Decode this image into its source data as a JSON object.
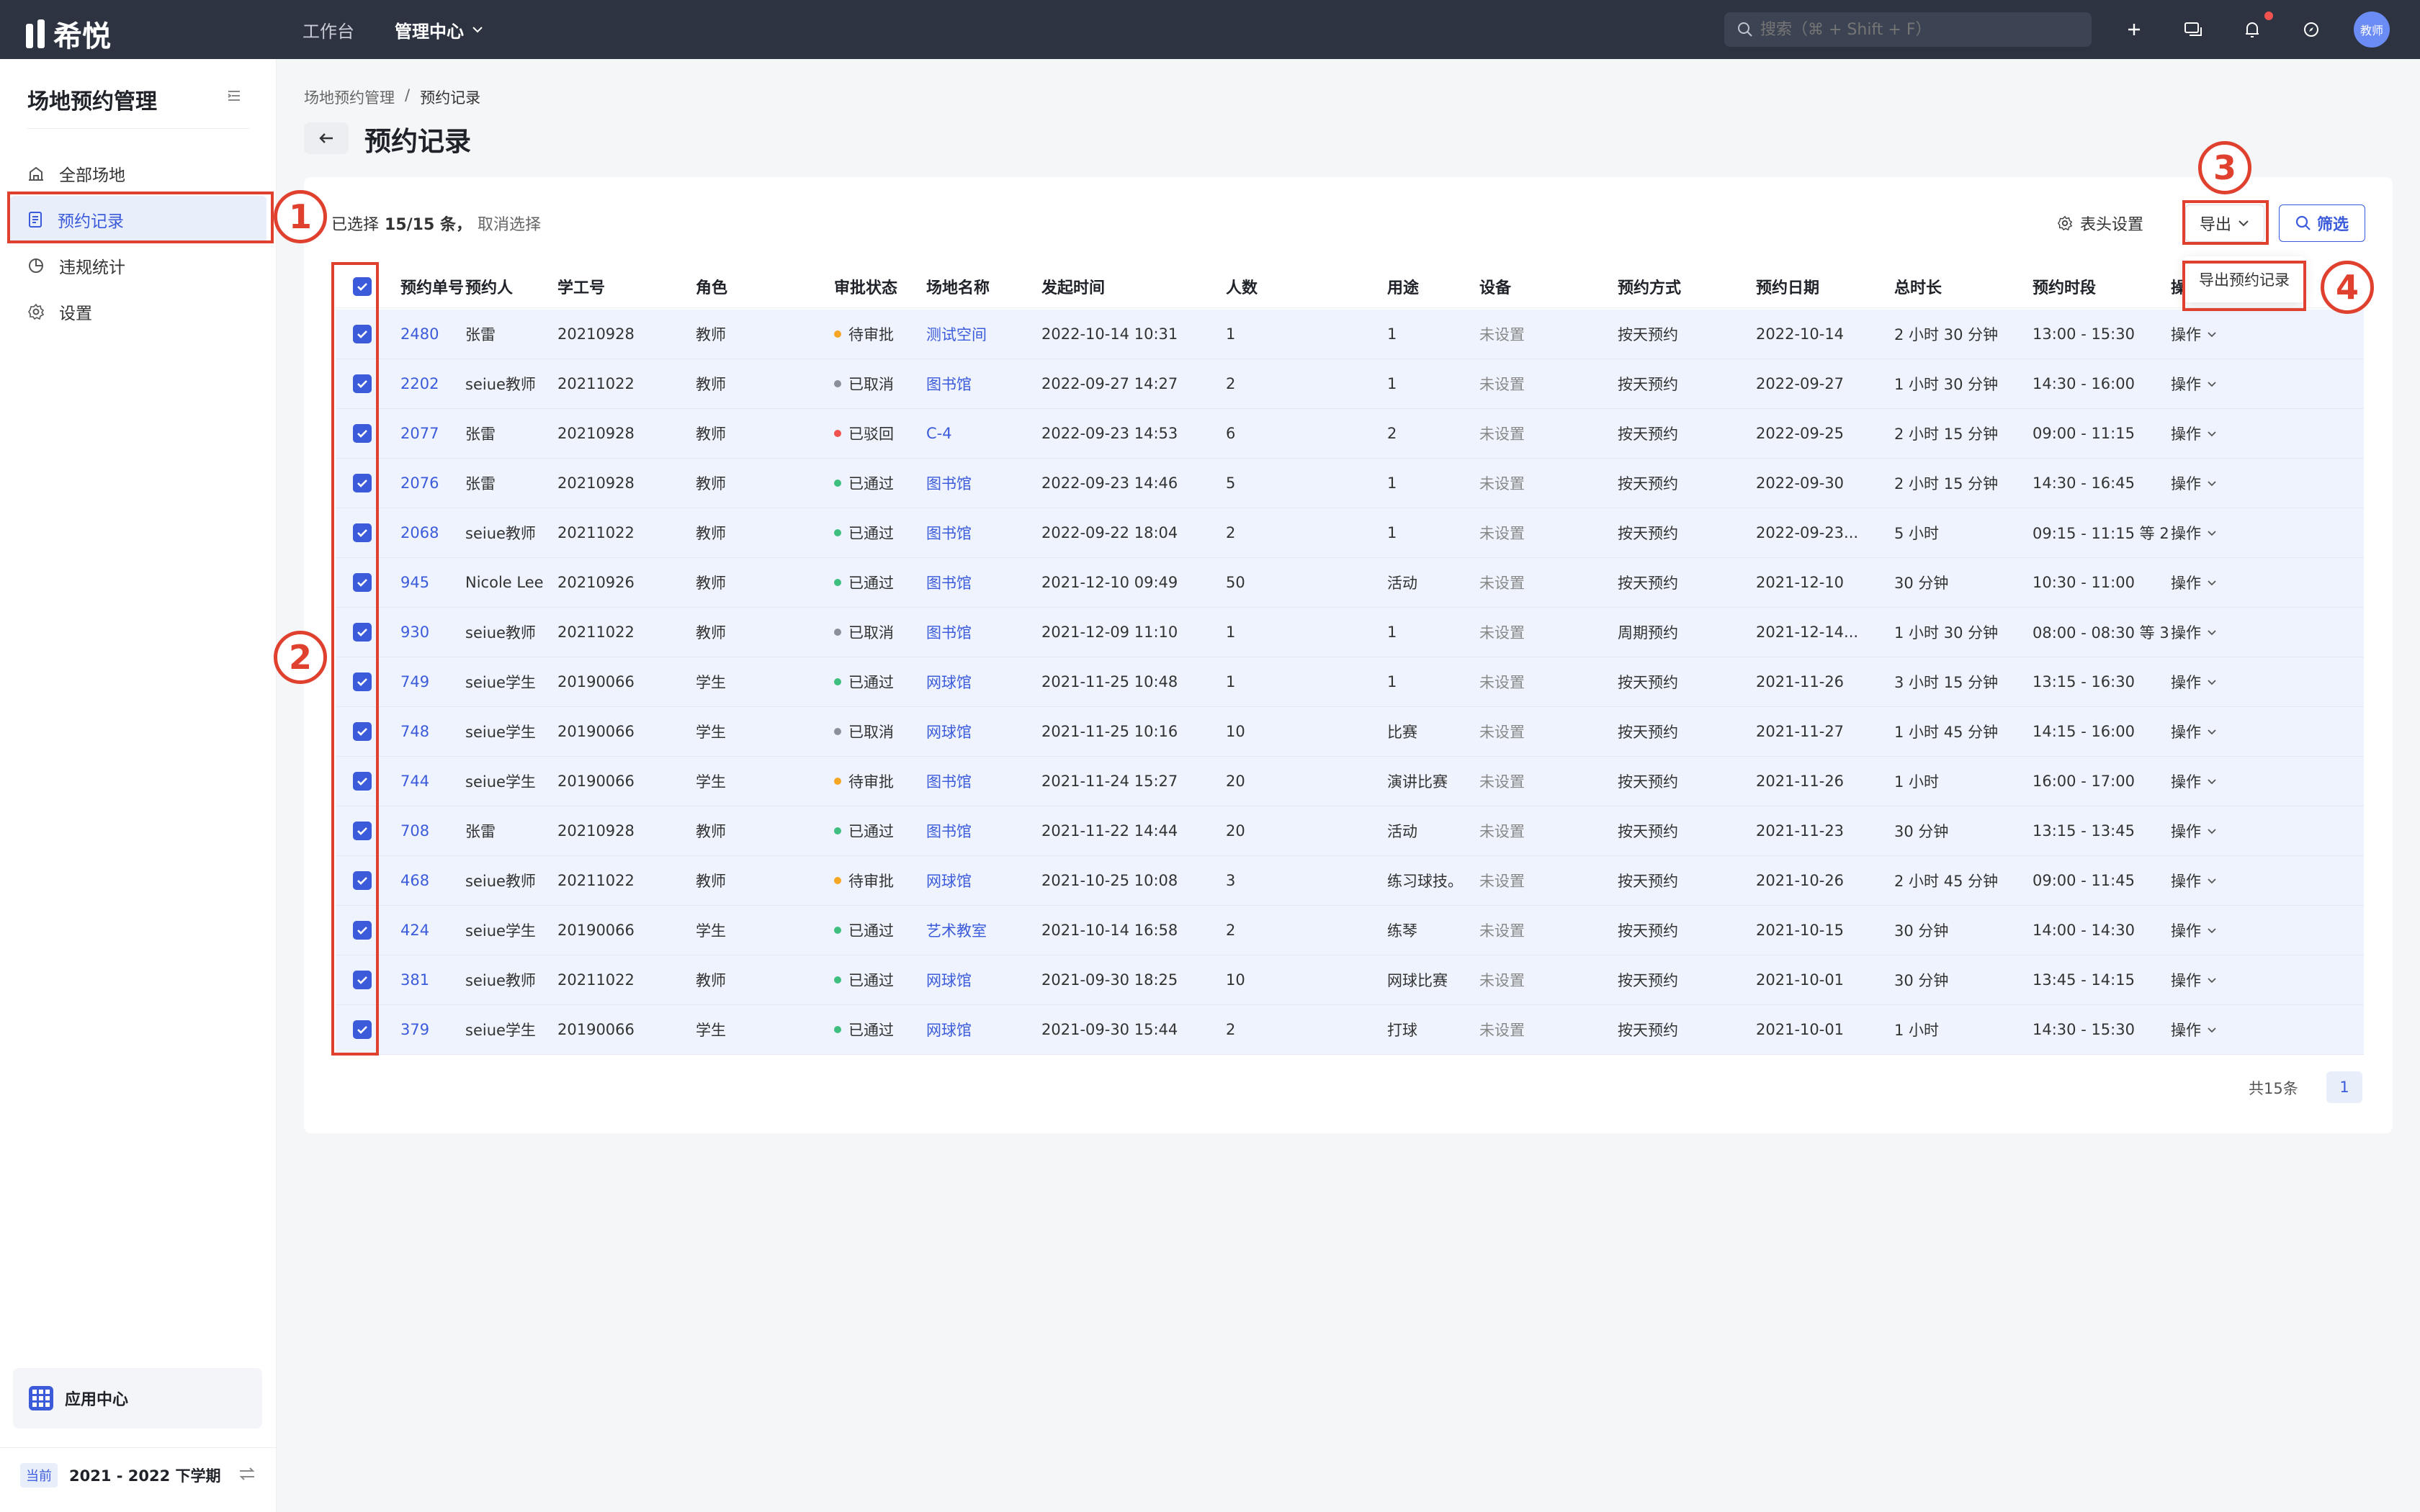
{
  "app": {
    "logo_text": "希悦"
  },
  "topnav": {
    "workspace": "工作台",
    "admin_center": "管理中心"
  },
  "search": {
    "placeholder": "搜索（⌘ + Shift + F）"
  },
  "avatar": {
    "label": "教师"
  },
  "sidebar": {
    "title": "场地预约管理",
    "items": [
      {
        "label": "全部场地",
        "icon": "venue-icon"
      },
      {
        "label": "预约记录",
        "icon": "document-icon"
      },
      {
        "label": "违规统计",
        "icon": "pie-chart-icon"
      },
      {
        "label": "设置",
        "icon": "gear-icon"
      }
    ],
    "app_center": "应用中心",
    "term_tag": "当前",
    "term": "2021 - 2022 下学期"
  },
  "breadcrumb": {
    "parent": "场地预约管理",
    "separator": "/",
    "current": "预约记录"
  },
  "page_title": "预约记录",
  "toolbar": {
    "selected_prefix": "已选择",
    "selected_count": "15/15 条，",
    "cancel_selection": "取消选择",
    "column_settings": "表头设置",
    "export": "导出",
    "filter": "筛选",
    "export_menu_item": "导出预约记录"
  },
  "table": {
    "columns": [
      "预约单号",
      "预约人",
      "学工号",
      "角色",
      "审批状态",
      "场地名称",
      "发起时间",
      "人数",
      "用途",
      "设备",
      "预约方式",
      "预约日期",
      "总时长",
      "预约时段",
      "操作"
    ],
    "rows": [
      [
        "2480",
        "张雷",
        "20210928",
        "教师",
        "待审批",
        "测试空间",
        "2022-10-14 10:31",
        "1",
        "1",
        "未设置",
        "按天预约",
        "2022-10-14",
        "2 小时 30 分钟",
        "13:00 - 15:30",
        "操作"
      ],
      [
        "2202",
        "seiue教师",
        "20211022",
        "教师",
        "已取消",
        "图书馆",
        "2022-09-27 14:27",
        "2",
        "1",
        "未设置",
        "按天预约",
        "2022-09-27",
        "1 小时 30 分钟",
        "14:30 - 16:00",
        "操作"
      ],
      [
        "2077",
        "张雷",
        "20210928",
        "教师",
        "已驳回",
        "C-4",
        "2022-09-23 14:53",
        "6",
        "2",
        "未设置",
        "按天预约",
        "2022-09-25",
        "2 小时 15 分钟",
        "09:00 - 11:15",
        "操作"
      ],
      [
        "2076",
        "张雷",
        "20210928",
        "教师",
        "已通过",
        "图书馆",
        "2022-09-23 14:46",
        "5",
        "1",
        "未设置",
        "按天预约",
        "2022-09-30",
        "2 小时 15 分钟",
        "14:30 - 16:45",
        "操作"
      ],
      [
        "2068",
        "seiue教师",
        "20211022",
        "教师",
        "已通过",
        "图书馆",
        "2022-09-22 18:04",
        "2",
        "1",
        "未设置",
        "按天预约",
        "2022-09-23...",
        "5 小时",
        "09:15 - 11:15 等 2 ...",
        "操作"
      ],
      [
        "945",
        "Nicole Lee",
        "20210926",
        "教师",
        "已通过",
        "图书馆",
        "2021-12-10 09:49",
        "50",
        "活动",
        "未设置",
        "按天预约",
        "2021-12-10",
        "30 分钟",
        "10:30 - 11:00",
        "操作"
      ],
      [
        "930",
        "seiue教师",
        "20211022",
        "教师",
        "已取消",
        "图书馆",
        "2021-12-09 11:10",
        "1",
        "1",
        "未设置",
        "周期预约",
        "2021-12-14...",
        "1 小时 30 分钟",
        "08:00 - 08:30 等 3 ...",
        "操作"
      ],
      [
        "749",
        "seiue学生",
        "20190066",
        "学生",
        "已通过",
        "网球馆",
        "2021-11-25 10:48",
        "1",
        "1",
        "未设置",
        "按天预约",
        "2021-11-26",
        "3 小时 15 分钟",
        "13:15 - 16:30",
        "操作"
      ],
      [
        "748",
        "seiue学生",
        "20190066",
        "学生",
        "已取消",
        "网球馆",
        "2021-11-25 10:16",
        "10",
        "比赛",
        "未设置",
        "按天预约",
        "2021-11-27",
        "1 小时 45 分钟",
        "14:15 - 16:00",
        "操作"
      ],
      [
        "744",
        "seiue学生",
        "20190066",
        "学生",
        "待审批",
        "图书馆",
        "2021-11-24 15:27",
        "20",
        "演讲比赛",
        "未设置",
        "按天预约",
        "2021-11-26",
        "1 小时",
        "16:00 - 17:00",
        "操作"
      ],
      [
        "708",
        "张雷",
        "20210928",
        "教师",
        "已通过",
        "图书馆",
        "2021-11-22 14:44",
        "20",
        "活动",
        "未设置",
        "按天预约",
        "2021-11-23",
        "30 分钟",
        "13:15 - 13:45",
        "操作"
      ],
      [
        "468",
        "seiue教师",
        "20211022",
        "教师",
        "待审批",
        "网球馆",
        "2021-10-25 10:08",
        "3",
        "练习球技。",
        "未设置",
        "按天预约",
        "2021-10-26",
        "2 小时 45 分钟",
        "09:00 - 11:45",
        "操作"
      ],
      [
        "424",
        "seiue学生",
        "20190066",
        "学生",
        "已通过",
        "艺术教室",
        "2021-10-14 16:58",
        "2",
        "练琴",
        "未设置",
        "按天预约",
        "2021-10-15",
        "30 分钟",
        "14:00 - 14:30",
        "操作"
      ],
      [
        "381",
        "seiue教师",
        "20211022",
        "教师",
        "已通过",
        "网球馆",
        "2021-09-30 18:25",
        "10",
        "网球比赛",
        "未设置",
        "按天预约",
        "2021-10-01",
        "30 分钟",
        "13:45 - 14:15",
        "操作"
      ],
      [
        "379",
        "seiue学生",
        "20190066",
        "学生",
        "已通过",
        "网球馆",
        "2021-09-30 15:44",
        "2",
        "打球",
        "未设置",
        "按天预约",
        "2021-10-01",
        "1 小时",
        "14:30 - 15:30",
        "操作"
      ]
    ]
  },
  "status_colors": {
    "待审批": "#f5a623",
    "已取消": "#8a8f99",
    "已驳回": "#f0524f",
    "已通过": "#3fbf7f"
  },
  "pagination": {
    "total": "共15条",
    "page": "1"
  },
  "annotations": [
    "1",
    "2",
    "3",
    "4"
  ],
  "colors": {
    "accent": "#3b5bdb",
    "topbar": "#2d3340",
    "annotation": "#e0412f",
    "row_selected": "#eef3fd"
  }
}
